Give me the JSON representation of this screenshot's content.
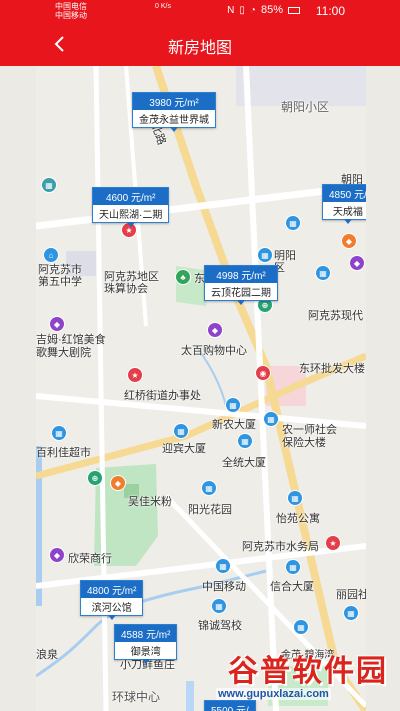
{
  "statusbar": {
    "carrier1": "中国电信",
    "carrier2": "中国移动",
    "speed": "0 K/s",
    "battery": "85%",
    "time": "11:00"
  },
  "header": {
    "title": "新房地图"
  },
  "markers": [
    {
      "price": "3980 元/m²",
      "name": "金茂永益世界城"
    },
    {
      "price": "4600 元/m²",
      "name": "天山熙湖·二期"
    },
    {
      "price": "4998 元/m²",
      "name": "云顶花园二期"
    },
    {
      "price": "4850 元/",
      "name": "天成福"
    },
    {
      "price": "4800 元/m²",
      "name": "滨河公馆"
    },
    {
      "price": "4588 元/m²",
      "name": "御景湾"
    },
    {
      "price": "5500 元/",
      "name": ""
    }
  ],
  "pois": {
    "chaoyang_district": "朝阳小区",
    "chaoyang": "朝阳",
    "beilu": "北路",
    "akesu_5th_school": "阿克苏市 第五中学",
    "zhusuan": "阿克苏地区 珠算协会",
    "dong": "东",
    "mingyang": "明阳 区",
    "xiandai": "阿克苏现代",
    "meishi": "吉姆·红馆美食 歌舞大剧院",
    "baibai": "太百购物中心",
    "pifa": "东环批发大楼",
    "hongqiao": "红桥街道办事处",
    "xinnong": "新农大厦",
    "nongyi": "农一师社会 保险大楼",
    "baili": "百利佳超市",
    "yingbin": "迎宾大厦",
    "quancheng": "全统大厦",
    "wujia": "吴佳米粉",
    "yangguang": "阳光花园",
    "yiyuan": "怡苑公寓",
    "shuiwu": "阿克苏市水务局",
    "xinrong": "欣荣商行",
    "chinamobile": "中国移动",
    "xincheng": "信合大厦",
    "lize": "丽园社",
    "jinxiang": "锦诚驾校",
    "langquan": "浪泉",
    "xiaodao": "小刀鲜鱼庄",
    "huanqiu": "环球中心",
    "jinfeng": "金茂·碧海湾"
  },
  "watermark": {
    "big": "谷普软件园",
    "url": "www.gupuxlazai.com"
  }
}
